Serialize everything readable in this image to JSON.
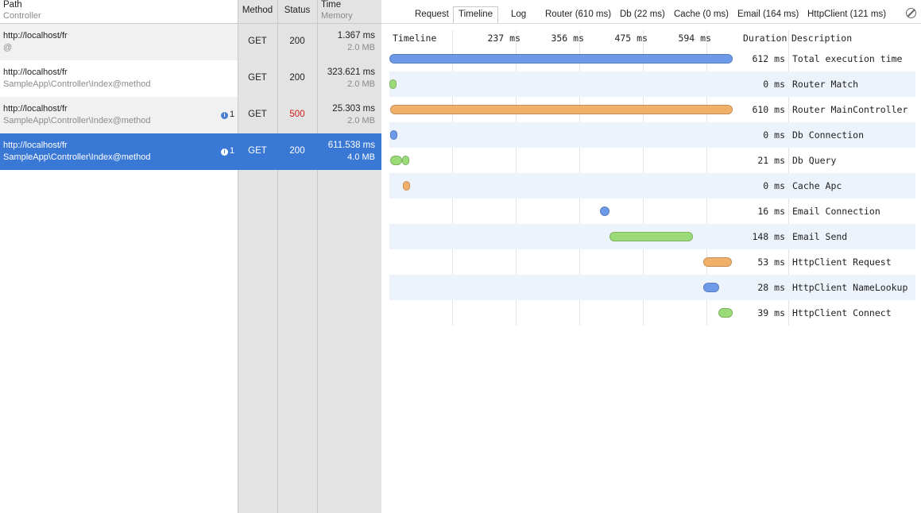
{
  "colors": {
    "selected_row": "#3a78d6",
    "error_status": "#d01b1b",
    "seg_blue": "#6d9ae8",
    "seg_green": "#9bdb78",
    "seg_orange": "#f0b06a"
  },
  "requests_header": {
    "path": "Path",
    "controller": "Controller",
    "method": "Method",
    "status": "Status",
    "time": "Time",
    "memory": "Memory"
  },
  "requests": [
    {
      "url": "http://localhost/fr",
      "controller": "@",
      "method": "GET",
      "status": "200",
      "time": "1.367 ms",
      "memory": "2.0 MB",
      "badge": ""
    },
    {
      "url": "http://localhost/fr",
      "controller": "SampleApp\\Controller\\Index@method",
      "method": "GET",
      "status": "200",
      "time": "323.621 ms",
      "memory": "2.0 MB",
      "badge": ""
    },
    {
      "url": "http://localhost/fr",
      "controller": "SampleApp\\Controller\\Index@method",
      "method": "GET",
      "status": "500",
      "time": "25.303 ms",
      "memory": "2.0 MB",
      "badge": "1"
    },
    {
      "url": "http://localhost/fr",
      "controller": "SampleApp\\Controller\\Index@method",
      "method": "GET",
      "status": "200",
      "time": "611.538 ms",
      "memory": "4.0 MB",
      "badge": "1"
    }
  ],
  "selected_request": 3,
  "tabs": [
    {
      "label": "Request"
    },
    {
      "label": "Timeline"
    },
    {
      "label": "Log"
    },
    {
      "label": "Router (610 ms)"
    },
    {
      "label": "Db (22 ms)"
    },
    {
      "label": "Cache (0 ms)"
    },
    {
      "label": "Email (164 ms)"
    },
    {
      "label": "HttpClient (121 ms)"
    }
  ],
  "active_tab": 1,
  "clear_icon": "clear-icon",
  "timeline": {
    "header": {
      "timeline": "Timeline",
      "duration": "Duration",
      "description": "Description"
    },
    "ticks": [
      "237 ms",
      "356 ms",
      "475 ms",
      "594 ms"
    ],
    "total_ms": 612,
    "entries": [
      {
        "duration": "612 ms",
        "description": "Total execution time",
        "color": "blue",
        "segments": [
          [
            0,
            612
          ]
        ]
      },
      {
        "duration": "0 ms",
        "description": "Router Match",
        "color": "green",
        "segments": [
          [
            0,
            12
          ]
        ]
      },
      {
        "duration": "610 ms",
        "description": "Router MainController",
        "color": "orange",
        "segments": [
          [
            1,
            612
          ]
        ]
      },
      {
        "duration": "0 ms",
        "description": "Db Connection",
        "color": "blue",
        "segments": [
          [
            1,
            12
          ]
        ]
      },
      {
        "duration": "21 ms",
        "description": "Db Query",
        "color": "green",
        "segments": [
          [
            1,
            23
          ],
          [
            23,
            35
          ]
        ]
      },
      {
        "duration": "0 ms",
        "description": "Cache Apc",
        "color": "orange",
        "segments": [
          [
            24,
            36
          ]
        ]
      },
      {
        "duration": "16 ms",
        "description": "Email Connection",
        "color": "blue",
        "segments": [
          [
            376,
            393
          ]
        ]
      },
      {
        "duration": "148 ms",
        "description": "Email Send",
        "color": "green",
        "segments": [
          [
            393,
            541
          ]
        ]
      },
      {
        "duration": "53 ms",
        "description": "HttpClient Request",
        "color": "orange",
        "segments": [
          [
            559,
            611
          ]
        ]
      },
      {
        "duration": "28 ms",
        "description": "HttpClient NameLookup",
        "color": "blue",
        "segments": [
          [
            559,
            588
          ]
        ]
      },
      {
        "duration": "39 ms",
        "description": "HttpClient Connect",
        "color": "green",
        "segments": [
          [
            587,
            612
          ]
        ]
      }
    ]
  }
}
